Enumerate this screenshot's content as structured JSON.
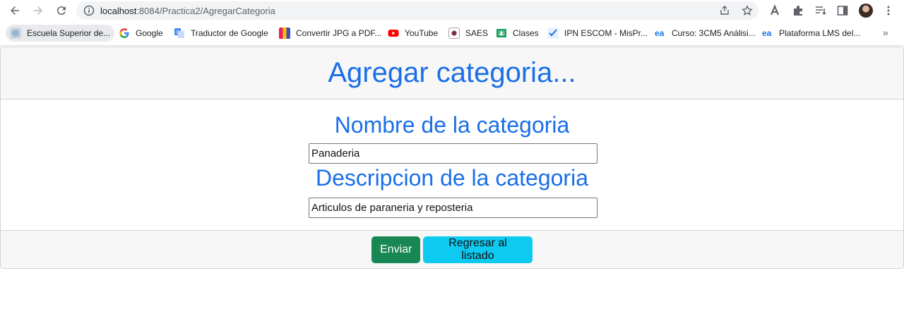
{
  "browser": {
    "url_host": "localhost",
    "url_rest": ":8084/Practica2/AgregarCategoria",
    "bookmarks": [
      {
        "label": "Escuela Superior de...",
        "icon": "escom-logo-icon"
      },
      {
        "label": "Google",
        "icon": "google-icon"
      },
      {
        "label": "Traductor de Google",
        "icon": "translate-icon"
      },
      {
        "label": "Convertir JPG a PDF...",
        "icon": "converter-icon"
      },
      {
        "label": "YouTube",
        "icon": "youtube-icon"
      },
      {
        "label": "SAES",
        "icon": "saes-icon"
      },
      {
        "label": "Clases",
        "icon": "classroom-icon"
      },
      {
        "label": "IPN ESCOM - MisPr...",
        "icon": "check-icon"
      },
      {
        "label": "Curso: 3CM5 Análisi...",
        "icon": "ea-icon"
      },
      {
        "label": "Plataforma LMS del...",
        "icon": "ea-icon"
      }
    ],
    "more_bookmarks": "»"
  },
  "page": {
    "header_title": "Agregar categoria...",
    "name_label": "Nombre de la categoria",
    "name_value": "Panaderia",
    "description_label": "Descripcion de la categoria",
    "description_value": "Articulos de paraneria y reposteria",
    "submit_label": "Enviar",
    "back_label": "Regresar al listado"
  },
  "colors": {
    "heading": "#1a6fe8",
    "success": "#198754",
    "info": "#0dcaf0"
  }
}
